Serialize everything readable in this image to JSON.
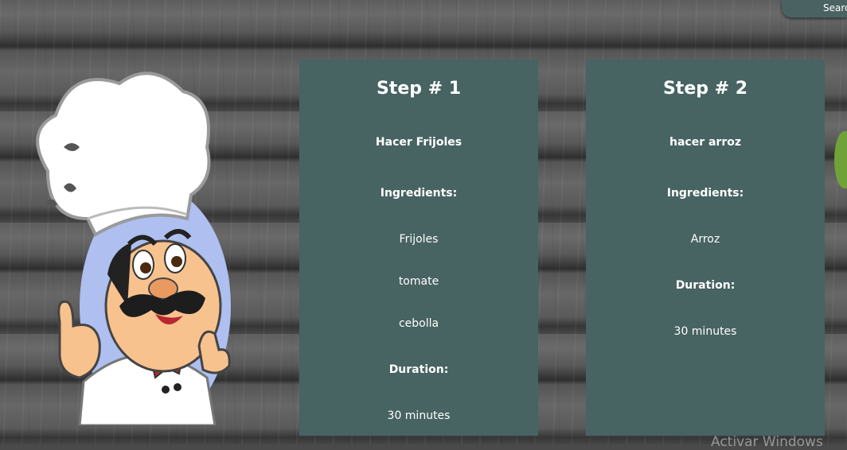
{
  "header": {
    "search_label": "Search"
  },
  "steps": [
    {
      "title": "Step # 1",
      "name": "Hacer Frijoles",
      "ingredients_label": "Ingredients:",
      "ingredients": [
        "Frijoles",
        "tomate",
        "cebolla"
      ],
      "duration_label": "Duration:",
      "duration": "30 minutes"
    },
    {
      "title": "Step # 2",
      "name": "hacer arroz",
      "ingredients_label": "Ingredients:",
      "ingredients": [
        "Arroz"
      ],
      "duration_label": "Duration:",
      "duration": "30 minutes"
    }
  ],
  "watermark": "Activar Windows",
  "colors": {
    "card": "#476362",
    "button": "#4a6362",
    "text": "#ffffff"
  }
}
